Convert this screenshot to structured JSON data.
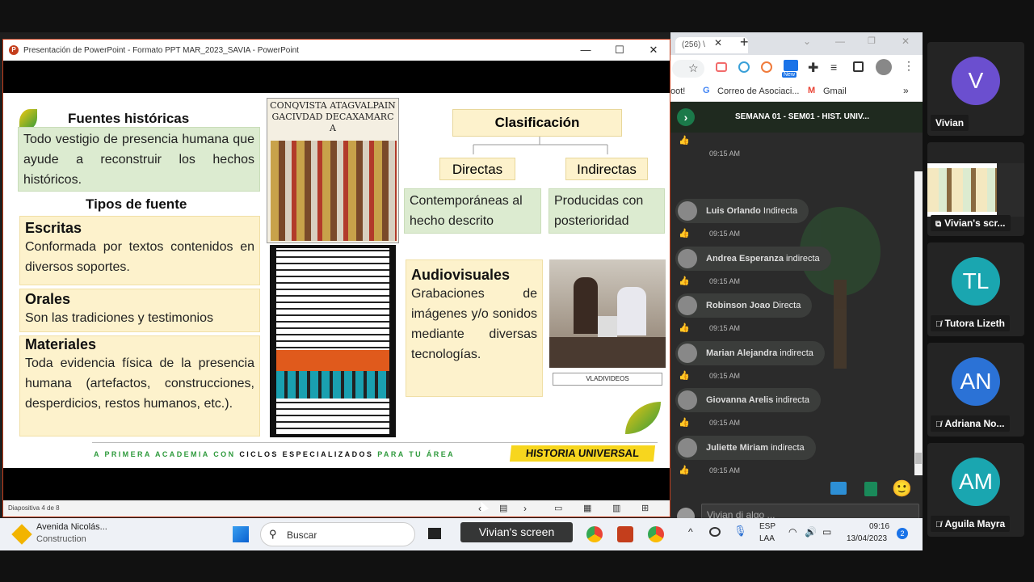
{
  "ppt": {
    "title": "Presentación de PowerPoint  -  Formato PPT MAR_2023_SAVIA  -  PowerPoint",
    "minimize": "—",
    "maximize": "☐",
    "close": "✕",
    "status": "Diapositiva 4 de 8"
  },
  "slide": {
    "fuentes_title": "Fuentes históricas",
    "fuentes_text": "Todo vestigio de presencia humana que ayude a reconstruir los hechos históricos.",
    "tipos_title": "Tipos de fuente",
    "escritas_title": "Escritas",
    "escritas_text": "Conformada por textos contenidos en diversos soportes.",
    "orales_title": "Orales",
    "orales_text": "Son las tradiciones y testimonios",
    "materiales_title": "Materiales",
    "materiales_text": "Toda evidencia física de la presencia humana (artefactos, construcciones, desperdicios, restos humanos, etc.).",
    "clasificacion": "Clasificación",
    "directas": "Directas",
    "indirectas": "Indirectas",
    "directas_text": "Contemporáneas al hecho descrito",
    "indirectas_text": "Producidas con posterioridad",
    "audiovisuales_title": "Audiovisuales",
    "audiovisuales_text": "Grabaciones de imágenes y/o sonidos mediante diversas tecnologías.",
    "video_caption": "VLADIVIDEOS",
    "codex_text": "CONQVISTA ATAGVALPAINGACIVDAD DECAXAMARCA",
    "footer_left_a": "A PRIMERA ACADEMIA CON ",
    "footer_left_b": "CICLOS ESPECIALIZADOS",
    "footer_left_c": " PARA TU ÁREA",
    "footer_right": "HISTORIA UNIVERSAL"
  },
  "chrome": {
    "tab": "(256) \\",
    "bookmarks": [
      "oot!",
      "Correo de Asociaci...",
      "Gmail"
    ],
    "new_badge": "New"
  },
  "chat": {
    "header": "SEMANA 01 - SEM01 - HIST. UNIV...",
    "messages": [
      {
        "name": "Luis Orlando",
        "text": "Indirecta",
        "time": "09:15 AM"
      },
      {
        "name": "Andrea Esperanza",
        "text": "indirecta",
        "time": "09:15 AM"
      },
      {
        "name": "Robinson Joao",
        "text": "Directa",
        "time": "09:15 AM"
      },
      {
        "name": "Marian Alejandra",
        "text": "indirecta",
        "time": "09:15 AM"
      },
      {
        "name": "Giovanna Arelis",
        "text": "indirecta",
        "time": "09:15 AM"
      },
      {
        "name": "Juliette Miriam",
        "text": "indirecta",
        "time": "09:15 AM"
      }
    ],
    "first_time": "09:15 AM",
    "input_placeholder": "Vivian di algo ..."
  },
  "taskbar": {
    "weather_title": "Avenida Nicolás...",
    "weather_sub": "Construction",
    "search": "Buscar",
    "lang1": "ESP",
    "lang2": "LAA",
    "time": "09:16",
    "date": "13/04/2023",
    "badge": "2"
  },
  "caption": "Vivian's screen",
  "participants": [
    {
      "initials": "V",
      "name": "Vivian",
      "color": "#6b4fcf",
      "muted": false
    },
    {
      "initials": "",
      "name": "Vivian's scr...",
      "color": "#242424",
      "muted": false
    },
    {
      "initials": "TL",
      "name": "Tutora Lizeth",
      "color": "#1aa6b0",
      "muted": true
    },
    {
      "initials": "AN",
      "name": "Adriana No...",
      "color": "#2b72d6",
      "muted": true
    },
    {
      "initials": "AM",
      "name": "Aguila Mayra",
      "color": "#1aa6b0",
      "muted": true
    }
  ]
}
